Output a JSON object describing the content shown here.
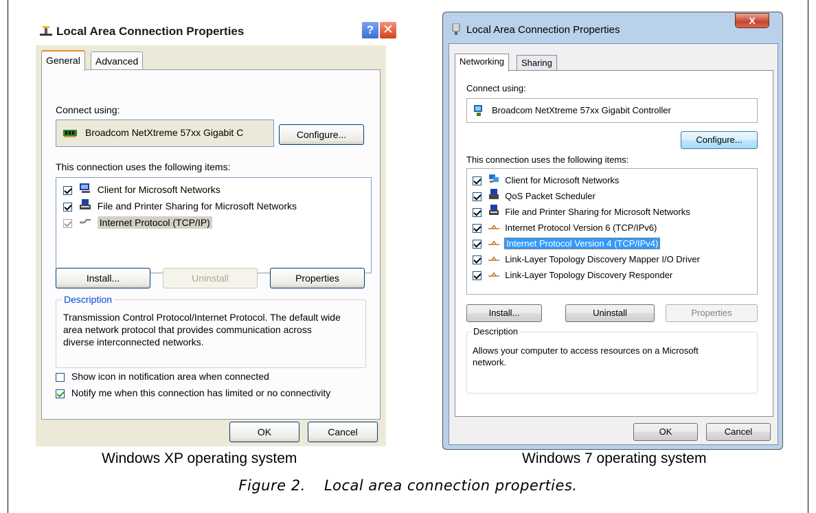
{
  "xp": {
    "title": "Local Area Connection Properties",
    "help_glyph": "?",
    "close_glyph": "✕",
    "tabs": [
      "General",
      "Advanced"
    ],
    "connect_using_label": "Connect using:",
    "adapter_name": "Broadcom NetXtreme 57xx Gigabit C",
    "configure_label": "Configure...",
    "items_label": "This connection uses the following items:",
    "items": [
      {
        "label": "Client for Microsoft Networks",
        "checked": true
      },
      {
        "label": "File and Printer Sharing for Microsoft Networks",
        "checked": true
      },
      {
        "label": "Internet Protocol (TCP/IP)",
        "checked": true
      }
    ],
    "install_label": "Install...",
    "uninstall_label": "Uninstall",
    "properties_label": "Properties",
    "description_legend": "Description",
    "description_text": "Transmission Control Protocol/Internet Protocol. The default wide area network protocol that provides communication across diverse interconnected networks.",
    "show_icon_label": "Show icon in notification area when connected",
    "notify_label": "Notify me when this connection has limited or no connectivity",
    "ok_label": "OK",
    "cancel_label": "Cancel"
  },
  "w7": {
    "title": "Local Area Connection Properties",
    "close_glyph": "X",
    "tabs": [
      "Networking",
      "Sharing"
    ],
    "connect_using_label": "Connect using:",
    "adapter_name": "Broadcom NetXtreme 57xx Gigabit Controller",
    "configure_label": "Configure...",
    "items_label": "This connection uses the following items:",
    "items": [
      {
        "label": "Client for Microsoft Networks",
        "checked": true
      },
      {
        "label": "QoS Packet Scheduler",
        "checked": true
      },
      {
        "label": "File and Printer Sharing for Microsoft Networks",
        "checked": true
      },
      {
        "label": "Internet Protocol Version 6 (TCP/IPv6)",
        "checked": true
      },
      {
        "label": "Internet Protocol Version 4 (TCP/IPv4)",
        "checked": true
      },
      {
        "label": "Link-Layer Topology Discovery Mapper I/O Driver",
        "checked": true
      },
      {
        "label": "Link-Layer Topology Discovery Responder",
        "checked": true
      }
    ],
    "install_label": "Install...",
    "uninstall_label": "Uninstall",
    "properties_label": "Properties",
    "description_legend": "Description",
    "description_text": "Allows your computer to access resources on a Microsoft network.",
    "ok_label": "OK",
    "cancel_label": "Cancel"
  },
  "captions": {
    "xp": "Windows XP operating system",
    "w7": "Windows 7 operating system",
    "figure_number": "Figure 2.",
    "figure_text": "Local area connection properties."
  }
}
